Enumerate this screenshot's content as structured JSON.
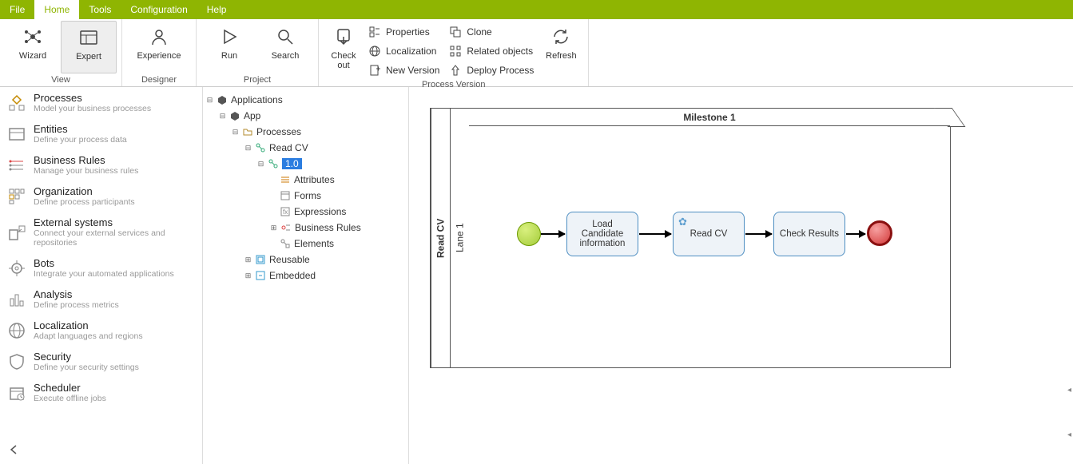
{
  "menu": {
    "file": "File",
    "home": "Home",
    "tools": "Tools",
    "configuration": "Configuration",
    "help": "Help"
  },
  "ribbon": {
    "groups": {
      "view": {
        "title": "View",
        "wizard": "Wizard",
        "expert": "Expert"
      },
      "designer": {
        "title": "Designer",
        "experience": "Experience"
      },
      "project": {
        "title": "Project",
        "run": "Run",
        "search": "Search"
      },
      "pv": {
        "title": "Process Version",
        "checkout": "Check\nout",
        "refresh": "Refresh",
        "properties": "Properties",
        "clone": "Clone",
        "localization": "Localization",
        "related": "Related objects",
        "newversion": "New Version",
        "deploy": "Deploy Process"
      }
    }
  },
  "nav": {
    "processes": {
      "t": "Processes",
      "s": "Model your business processes"
    },
    "entities": {
      "t": "Entities",
      "s": "Define your process data"
    },
    "rules": {
      "t": "Business Rules",
      "s": "Manage your business rules"
    },
    "org": {
      "t": "Organization",
      "s": "Define process participants"
    },
    "ext": {
      "t": "External systems",
      "s": "Connect your external services and repositories"
    },
    "bots": {
      "t": "Bots",
      "s": "Integrate your automated applications"
    },
    "analysis": {
      "t": "Analysis",
      "s": "Define process metrics"
    },
    "local": {
      "t": "Localization",
      "s": "Adapt languages and regions"
    },
    "security": {
      "t": "Security",
      "s": "Define your security settings"
    },
    "scheduler": {
      "t": "Scheduler",
      "s": "Execute offline jobs"
    }
  },
  "tree": {
    "root": "Applications",
    "app": "App",
    "processes": "Processes",
    "readcv": "Read CV",
    "version": "1.0",
    "attributes": "Attributes",
    "forms": "Forms",
    "expressions": "Expressions",
    "brules": "Business Rules",
    "elements": "Elements",
    "reusable": "Reusable",
    "embedded": "Embedded"
  },
  "diagram": {
    "poolTitle": "Read CV",
    "laneTitle": "Lane 1",
    "milestone": "Milestone 1",
    "task1": "Load Candidate information",
    "task2": "Read CV",
    "task3": "Check Results"
  }
}
